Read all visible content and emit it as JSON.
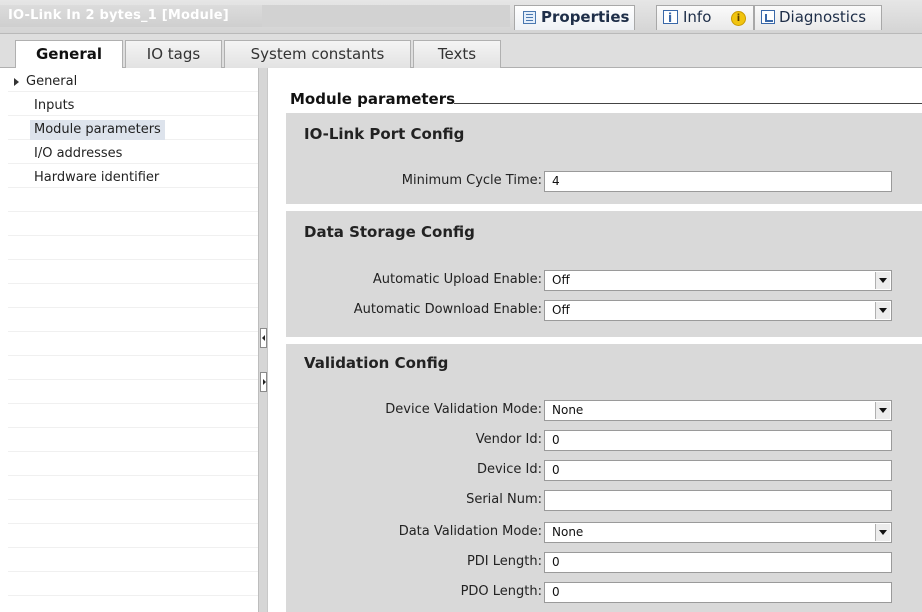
{
  "window": {
    "title": "IO-Link In 2 bytes_1 [Module]",
    "buttons": {
      "properties": "Properties",
      "info": "Info",
      "info_badge": "i",
      "diagnostics": "Diagnostics"
    }
  },
  "tabs": [
    "General",
    "IO tags",
    "System constants",
    "Texts"
  ],
  "nav": {
    "items": [
      "General",
      "Inputs",
      "Module parameters",
      "I/O addresses",
      "Hardware identifier"
    ],
    "selected": "Module parameters"
  },
  "main": {
    "section_title": "Module parameters",
    "port_config": {
      "title": "IO-Link Port Config",
      "min_cycle_label": "Minimum Cycle Time:",
      "min_cycle_value": "4"
    },
    "data_storage": {
      "title": "Data Storage Config",
      "auto_upload_label": "Automatic Upload Enable:",
      "auto_upload_value": "Off",
      "auto_download_label": "Automatic Download Enable:",
      "auto_download_value": "Off"
    },
    "validation": {
      "title": "Validation Config",
      "device_validation_label": "Device Validation Mode:",
      "device_validation_value": "None",
      "vendor_id_label": "Vendor Id:",
      "vendor_id_value": "0",
      "device_id_label": "Device Id:",
      "device_id_value": "0",
      "serial_num_label": "Serial Num:",
      "serial_num_value": "",
      "data_validation_label": "Data Validation Mode:",
      "data_validation_value": "None",
      "pdi_length_label": "PDI Length:",
      "pdi_length_value": "0",
      "pdo_length_label": "PDO Length:",
      "pdo_length_value": "0"
    }
  },
  "colors": {
    "group_bg": "#d9d9d9",
    "title_text": "#ffffff",
    "selection": "#dde3ec"
  }
}
